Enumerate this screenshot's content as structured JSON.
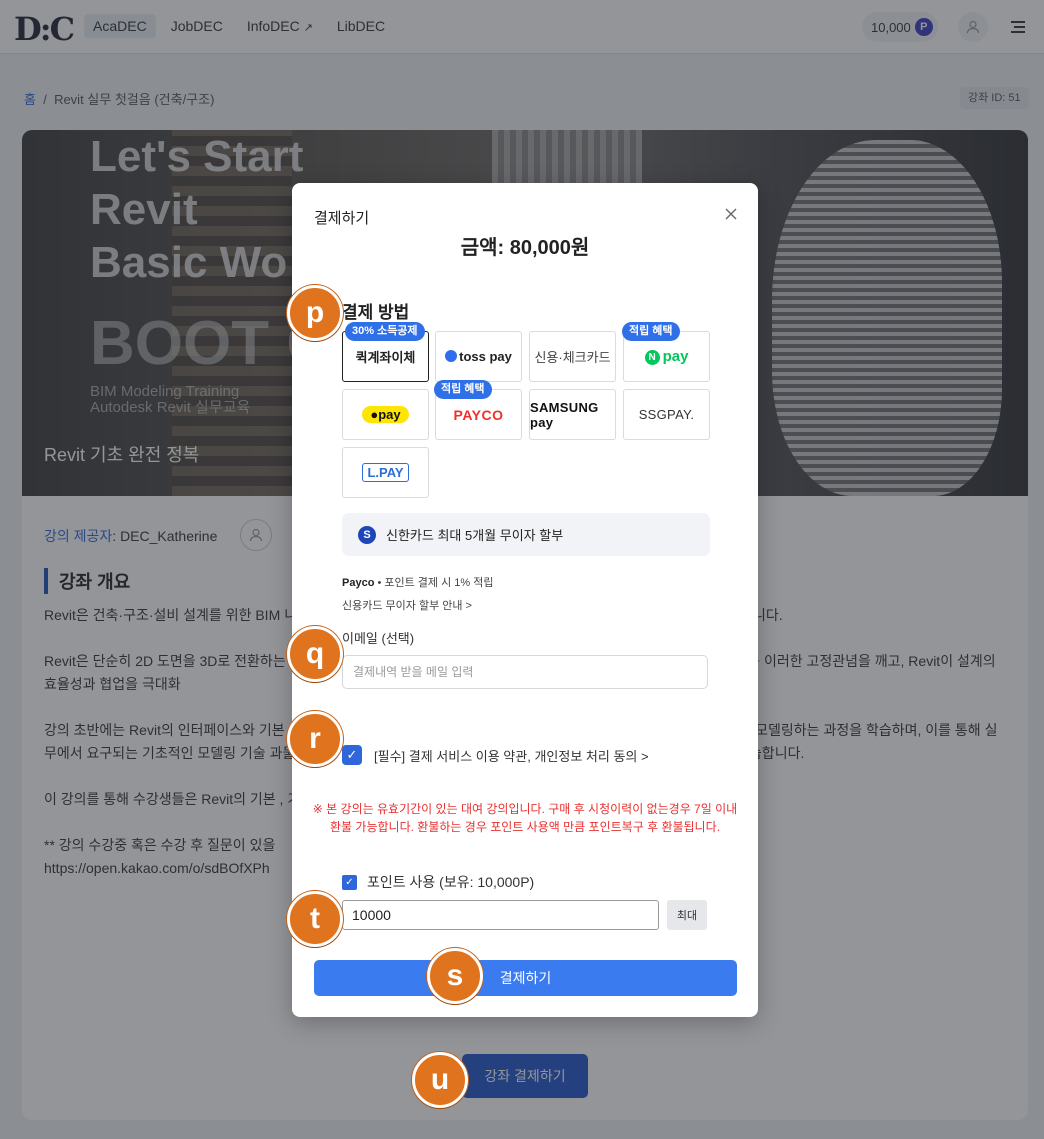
{
  "header": {
    "logo": "D:C",
    "nav": [
      {
        "label": "AcaDEC"
      },
      {
        "label": "JobDEC"
      },
      {
        "label": "InfoDEC"
      },
      {
        "label": "LibDEC"
      }
    ],
    "points": "10,000",
    "points_badge": "P"
  },
  "breadcrumb": {
    "home": "홈",
    "sep": "/",
    "current": "Revit 실무 첫걸음 (건축/구조)"
  },
  "course_id": "강좌 ID: 51",
  "hero": {
    "title_lines": [
      "Let's Start",
      "Revit",
      "Basic Wo"
    ],
    "boot": "BOOT C",
    "small_lines": [
      "BIM Modeling Training",
      "Autodesk Revit 실무교육"
    ],
    "subtitle": "Revit 기초 완전 정복"
  },
  "provider": {
    "label": "강의 제공자",
    "name": ": DEC_Katherine"
  },
  "section_title": "강좌 개요",
  "description": [
    "Revit은 건축·구조·설비 설계를 위한 BIM                                                                                    니다. 본 강의는 Revit을 처음 접하는 입문자를 대상으로 하며, 기본 개념부터                                                                                    었습니다.",
    "Revit은 단순히 2D 도면을 3D로 전환하는                                                                      ng Information Modeling) 소프트웨어입니다. 그러나 많은 사람이 Re                                                                      강의에서는 이러한 고정관념을 깨고, Revit이 설계의 효율성과 협업을 극대화",
    "강의 초반에는 Revit의 인터페이스와 기본                                                                           . 이후 함께 프로젝트를 설정하고, 기본 예제모델 실습과정을 통해 기초 모델링 방                                                                 모델링하는 과정을 학습하며, 이를 통해 실무에서 요구되는 기초적인 모델링 기술                                                               과물을 만들고, 시트 구성 및 출력 방법까지 실습합니다. CAD링크를 활용하                                                                         법을 학습합니다.",
    "이 강의를 통해 수강생들은 Revit의 기본                                                                           , 기존의 설계 방식에서 벗어나 더욱 스마트한 BIM 기반 설계가 가능할 것입니",
    "** 강의 수강중 혹은 수강 후 질문이 있을",
    "https://open.kakao.com/o/sdBOfXPh"
  ],
  "main_cta": "강좌 결제하기",
  "modal": {
    "title": "결제하기",
    "amount": "금액: 80,000원",
    "method_label": "결제 방법",
    "methods": [
      {
        "label": "퀵계좌이체",
        "tag": "30% 소득공제",
        "selected": true
      },
      {
        "label": "toss pay",
        "tag": ""
      },
      {
        "label": "신용·체크카드",
        "tag": ""
      },
      {
        "label": "pay",
        "tag": "적립 혜택"
      },
      {
        "label": "pay",
        "tag": ""
      },
      {
        "label": "PAYCO",
        "tag": "적립 혜택"
      },
      {
        "label": "SAMSUNG pay",
        "tag": ""
      },
      {
        "label": "SSGPAY.",
        "tag": ""
      },
      {
        "label": "L.PAY",
        "tag": ""
      }
    ],
    "shinhan_icon": "S",
    "shinhan": "신한카드 최대 5개월 무이자 할부",
    "payco_note_bold": "Payco",
    "payco_note": " • 포인트 결제 시 1% 적립",
    "card_note": "신용카드 무이자 할부 안내 >",
    "email_label": "이메일 (선택)",
    "email_placeholder": "결제내역 받을 메일 입력",
    "agree": "[필수] 결제 서비스 이용 약관, 개인정보 처리 동의 >",
    "warning": "※ 본 강의는 유효기간이 있는 대여 강의입니다. 구매 후 시청이력이 없는경우 7일 이내 환불 가능합니다. 환불하는 경우 포인트 사용액 만큼 포인트복구 후 환불됩니다.",
    "points_use": "포인트 사용 (보유: 10,000P)",
    "points_value": "10000",
    "max_button": "최대",
    "submit": "결제하기"
  },
  "markers": [
    "p",
    "q",
    "r",
    "s",
    "t",
    "u"
  ],
  "colors": {
    "primary": "#3b7bf0",
    "marker": "#e0731e",
    "warning": "#e8312f",
    "navy": "#2255c9"
  }
}
